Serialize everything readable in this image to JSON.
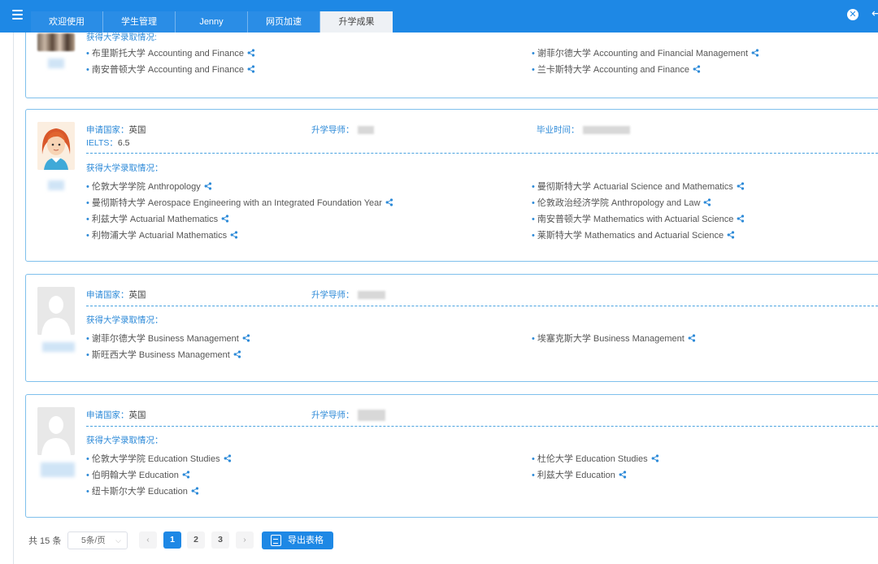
{
  "tabs": [
    {
      "label": "欢迎使用"
    },
    {
      "label": "学生管理"
    },
    {
      "label": "Jenny"
    },
    {
      "label": "网页加速"
    },
    {
      "label": "升学成果"
    }
  ],
  "labels": {
    "country": "申请国家：",
    "advisor": "升学导师：",
    "graduation": "毕业时间：",
    "ielts": "IELTS：",
    "offers": "获得大学录取情况："
  },
  "students": [
    {
      "offers_title": "获得大学录取情况:",
      "universities": [
        "布里斯托大学 Accounting and Finance",
        "谢菲尔德大学 Accounting and Financial Management",
        "南安普顿大学 Accounting and Finance",
        "兰卡斯特大学 Accounting and Finance"
      ]
    },
    {
      "country": "英国",
      "ielts": "6.5",
      "universities": [
        "伦敦大学学院 Anthropology",
        "曼彻斯特大学 Actuarial Science and Mathematics",
        "曼彻斯特大学 Aerospace Engineering with an Integrated Foundation Year",
        "伦敦政治经济学院 Anthropology and Law",
        "利兹大学 Actuarial Mathematics",
        "南安普顿大学 Mathematics with Actuarial Science",
        "利物浦大学 Actuarial Mathematics",
        "莱斯特大学 Mathematics and Actuarial Science"
      ]
    },
    {
      "country": "英国",
      "universities": [
        "谢菲尔德大学 Business Management",
        "埃塞克斯大学 Business Management",
        "斯旺西大学 Business Management"
      ]
    },
    {
      "country": "英国",
      "universities": [
        "伦敦大学学院 Education Studies",
        "杜伦大学 Education Studies",
        "伯明翰大学 Education",
        "利兹大学 Education",
        "纽卡斯尔大学 Education"
      ]
    }
  ],
  "pagination": {
    "total": "共 15 条",
    "page_size": "5条/页",
    "prev": "‹",
    "pages": [
      "1",
      "2",
      "3"
    ],
    "next": "›",
    "current": "1"
  },
  "export_label": "导出表格",
  "icons": {
    "menu": "menu-icon",
    "close": "close-circle-icon",
    "back": "arrow-icon",
    "share": "share-icon",
    "excel": "excel-icon"
  },
  "colors": {
    "primary": "#1e88e5",
    "label_blue": "#2d8ad8",
    "card_border": "#7fc0ec"
  }
}
